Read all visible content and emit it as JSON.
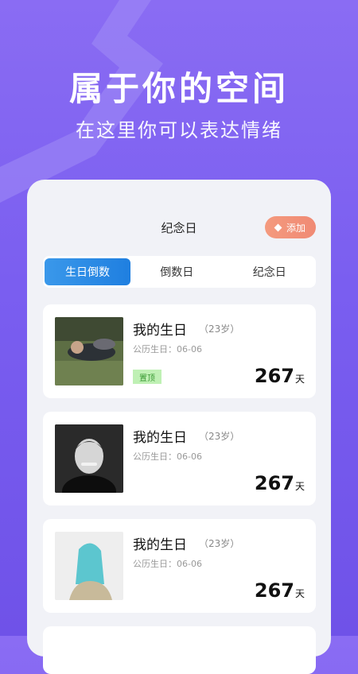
{
  "hero": {
    "title": "属于你的空间",
    "subtitle": "在这里你可以表达情绪"
  },
  "header": {
    "title": "纪念日",
    "add_label": "添加",
    "add_icon": "diamond-icon"
  },
  "tabs": [
    {
      "label": "生日倒数",
      "active": true
    },
    {
      "label": "倒数日",
      "active": false
    },
    {
      "label": "纪念日",
      "active": false
    }
  ],
  "cards": [
    {
      "title": "我的生日",
      "age": "（23岁）",
      "date": "公历生日：06-06",
      "pin": "置顶",
      "count": "267",
      "unit": "天"
    },
    {
      "title": "我的生日",
      "age": "（23岁）",
      "date": "公历生日：06-06",
      "count": "267",
      "unit": "天"
    },
    {
      "title": "我的生日",
      "age": "（23岁）",
      "date": "公历生日：06-06",
      "count": "267",
      "unit": "天"
    }
  ],
  "colors": {
    "background": "#7a5ef0",
    "accent_tab": "#1f7fe0",
    "add_button": "#f08a74",
    "pin_badge": "#bff0b4"
  }
}
